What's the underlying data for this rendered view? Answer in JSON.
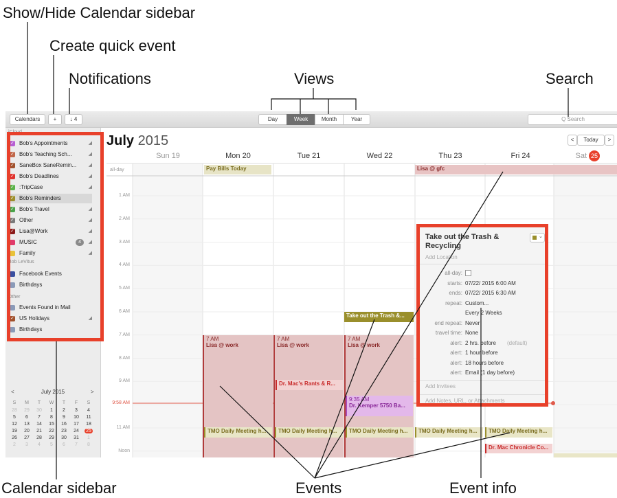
{
  "callouts": {
    "sidebar_toggle": "Show/Hide Calendar sidebar",
    "quick_event": "Create quick event",
    "notifications": "Notifications",
    "views": "Views",
    "search": "Search",
    "calendar_sidebar": "Calendar sidebar",
    "events": "Events",
    "event_info": "Event info"
  },
  "toolbar": {
    "calendars_label": "Calendars",
    "add_label": "+",
    "notifications_label": "↓ 4",
    "views": [
      "Day",
      "Week",
      "Month",
      "Year"
    ],
    "active_view": "Week",
    "search_placeholder": "Q Search"
  },
  "sidebar": {
    "icloud_header": "iCloud",
    "icloud_items": [
      {
        "label": "Bob's Appointments",
        "color": "#b75fd3",
        "checked": true,
        "shared": true
      },
      {
        "label": "Bob's Teaching Sch...",
        "color": "#c0684a",
        "checked": true,
        "shared": true
      },
      {
        "label": "SaneBox SaneRemin...",
        "color": "#a0522d",
        "checked": true,
        "shared": true
      },
      {
        "label": "Bob's Deadlines",
        "color": "#e0332e",
        "checked": true,
        "shared": true
      },
      {
        "label": ":TripCase",
        "color": "#59b44a",
        "checked": true,
        "shared": true
      },
      {
        "label": "Bob's Reminders",
        "color": "#9c8f2c",
        "checked": true,
        "shared": false
      },
      {
        "label": "Bob's Travel",
        "color": "#4aa24a",
        "checked": true,
        "shared": true
      },
      {
        "label": "Other",
        "color": "#7a7a7a",
        "checked": true,
        "shared": true
      },
      {
        "label": "Lisa@Work",
        "color": "#8a1a1a",
        "checked": true,
        "shared": true
      },
      {
        "label": "MUSIC",
        "color": "#e03a6a",
        "checked": false,
        "shared": true,
        "badge": "4"
      },
      {
        "label": "Family",
        "color": "#e8c23a",
        "checked": false,
        "shared": true
      }
    ],
    "boblevitus_header": "Bob LeVitus",
    "boblevitus_items": [
      {
        "label": "Facebook Events",
        "color": "#3a4fa0",
        "checked": false
      },
      {
        "label": "Birthdays",
        "color": "#8a9ab8",
        "checked": false
      }
    ],
    "other_header": "Other",
    "other_items": [
      {
        "label": "Events Found in Mail",
        "color": "#8a9ab8",
        "checked": false,
        "shared": false
      },
      {
        "label": "US Holidays",
        "color": "#a0522d",
        "checked": true,
        "shared": true
      },
      {
        "label": "Birthdays",
        "color": "#8a9ab8",
        "checked": false,
        "shared": false
      }
    ]
  },
  "mini_calendar": {
    "title": "July 2015",
    "prev": "<",
    "next": ">",
    "weekdays": [
      "S",
      "M",
      "T",
      "W",
      "T",
      "F",
      "S"
    ],
    "weeks": [
      [
        "28",
        "29",
        "30",
        "1",
        "2",
        "3",
        "4"
      ],
      [
        "5",
        "6",
        "7",
        "8",
        "9",
        "10",
        "11"
      ],
      [
        "12",
        "13",
        "14",
        "15",
        "16",
        "17",
        "18"
      ],
      [
        "19",
        "20",
        "21",
        "22",
        "23",
        "24",
        "25"
      ],
      [
        "26",
        "27",
        "28",
        "29",
        "30",
        "31",
        "1"
      ],
      [
        "2",
        "3",
        "4",
        "5",
        "6",
        "7",
        "8"
      ]
    ],
    "today": "25"
  },
  "calendar": {
    "month": "July",
    "year": "2015",
    "today_button": "Today",
    "prev": "<",
    "next": ">",
    "days": [
      "Sun 19",
      "Mon 20",
      "Tue 21",
      "Wed 22",
      "Thu 23",
      "Fri 24",
      "Sat"
    ],
    "today_number": "25",
    "allday_label": "all-day",
    "hours": [
      "1 AM",
      "2 AM",
      "3 AM",
      "4 AM",
      "5 AM",
      "6 AM",
      "7 AM",
      "8 AM",
      "9 AM",
      "11 AM",
      "Noon"
    ],
    "now_label": "9:58 AM",
    "allday_events": [
      {
        "title": "Pay Bills Today",
        "color": "#e7e4c6",
        "text_color": "#7a6d20"
      },
      {
        "title": "Lisa @ gfc",
        "color": "#e8c4c4",
        "text_color": "#8a2a2a"
      }
    ],
    "events": {
      "lisa_mon": {
        "time": "7 AM",
        "title": "Lisa @ work"
      },
      "lisa_tue": {
        "time": "7 AM",
        "title": "Lisa @ work"
      },
      "lisa_wed": {
        "time": "7 AM",
        "title": "Lisa @ work"
      },
      "trash": {
        "title": "Take out the Trash &..."
      },
      "rants": {
        "title": "Dr. Mac's Rants & R..."
      },
      "kemper": {
        "time": "9:35 AM",
        "title": "Dr. Kemper 5750 Ba..."
      },
      "tmo": [
        "TMO Daily Meeting h...",
        "TMO Daily Meeting h...",
        "TMO Daily Meeting h...",
        "TMO Daily Meeting h...",
        "TMO Daily Meeting h..."
      ],
      "chronicle": {
        "title": "Dr. Mac Chronicle Co..."
      }
    },
    "colors": {
      "work": "#e4c4c4",
      "work_bar": "#b03a3a",
      "trash": "#9a8f2c",
      "rants_bg": "#f3d2d2",
      "rants_text": "#c82a2a",
      "kemper_bg": "#e3b8ea",
      "kemper_text": "#8a2a9a",
      "tmo_bg": "#e9e6c7",
      "tmo_text": "#7a6d20",
      "now_line": "#e05a4a",
      "today_badge": "#e8402a",
      "highlight": "#e8402a"
    }
  },
  "event_info": {
    "title": "Take out the Trash & Recycling",
    "location_placeholder": "Add Location",
    "rows": [
      {
        "label": "all-day:",
        "value": ""
      },
      {
        "label": "starts:",
        "value": "07/22/ 2015    6:00 AM"
      },
      {
        "label": "ends:",
        "value": "07/22/ 2015    6:30 AM"
      },
      {
        "label": "repeat:",
        "value": "Custom..."
      },
      {
        "label": "",
        "value": "Every 2 Weeks"
      },
      {
        "label": "end repeat:",
        "value": "Never"
      },
      {
        "label": "travel time:",
        "value": "None"
      },
      {
        "label": "alert:",
        "value": "2 hrs. before",
        "extra": "(default)"
      },
      {
        "label": "alert:",
        "value": "1 hour before"
      },
      {
        "label": "alert:",
        "value": "18 hours before"
      },
      {
        "label": "alert:",
        "value": "Email (1 day before)"
      }
    ],
    "invitees_placeholder": "Add Invitees",
    "notes_placeholder": "Add Notes, URL, or Attachments"
  }
}
